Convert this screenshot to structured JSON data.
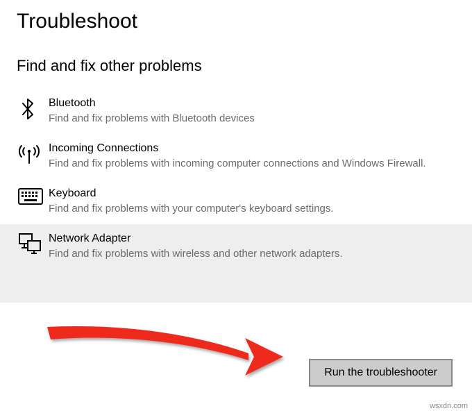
{
  "header": {
    "title": "Troubleshoot"
  },
  "section": {
    "title": "Find and fix other problems"
  },
  "items": [
    {
      "id": "bluetooth",
      "title": "Bluetooth",
      "desc": "Find and fix problems with Bluetooth devices"
    },
    {
      "id": "incoming-connections",
      "title": "Incoming Connections",
      "desc": "Find and fix problems with incoming computer connections and Windows Firewall."
    },
    {
      "id": "keyboard",
      "title": "Keyboard",
      "desc": "Find and fix problems with your computer's keyboard settings."
    },
    {
      "id": "network-adapter",
      "title": "Network Adapter",
      "desc": "Find and fix problems with wireless and other network adapters.",
      "selected": true
    }
  ],
  "button": {
    "run_label": "Run the troubleshooter"
  },
  "watermark": "wsxdn.com"
}
